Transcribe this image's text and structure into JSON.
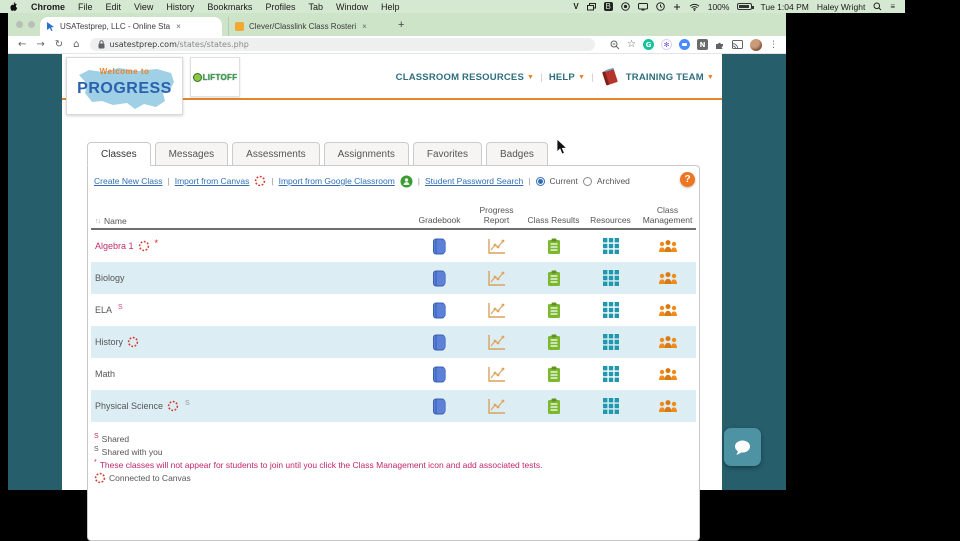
{
  "menubar": {
    "app": "Chrome",
    "items": [
      "File",
      "Edit",
      "View",
      "History",
      "Bookmarks",
      "Profiles",
      "Tab",
      "Window",
      "Help"
    ],
    "status": {
      "battery": "100%",
      "time": "Tue 1:04 PM",
      "user": "Haley Wright"
    },
    "status_icons": [
      "onepassword-icon",
      "windows-icon",
      "box-icon",
      "record-icon",
      "display-icon",
      "timemachine-icon",
      "input-icon",
      "wifi-icon",
      "spotlight-icon",
      "control-center-icon"
    ]
  },
  "browser": {
    "tabs": [
      {
        "title": "USATestprep, LLC - Online Sta",
        "close": "×"
      },
      {
        "title": "Clever/Classlink Class Rosteri",
        "close": "×"
      }
    ],
    "newtab": "+",
    "back": "←",
    "forward": "→",
    "reload": "↻",
    "home": "⌂",
    "url_domain": "usatestprep.com",
    "url_path": "/states/states.php",
    "star": "☆",
    "menu_dots": "⋮",
    "ext_g_label": "G",
    "ext_n_label": "N",
    "ext_flower": "✻"
  },
  "site": {
    "logo_line1": "Welcome to",
    "logo_line2": "PROGRESS",
    "liftoff_label": "LIFTOFF",
    "nav": [
      {
        "label": "CLASSROOM RESOURCES",
        "arrow": "▼"
      },
      {
        "label": "HELP",
        "arrow": "▼"
      },
      {
        "label": "TRAINING TEAM",
        "arrow": "▼",
        "icon": "training-book-icon"
      }
    ],
    "nav_separator": "|"
  },
  "tabs": {
    "active_index": 0,
    "items": [
      "Classes",
      "Messages",
      "Assessments",
      "Assignments",
      "Favorites",
      "Badges"
    ]
  },
  "linksrow": {
    "links": [
      {
        "label": "Create New Class"
      },
      {
        "label": "Import from Canvas",
        "icon": "canvas-icon"
      },
      {
        "label": "Import from Google Classroom",
        "icon": "google-classroom-icon"
      },
      {
        "label": "Student Password Search"
      }
    ],
    "separator": "|",
    "radio_current": {
      "label": "Current",
      "selected": true
    },
    "radio_archived": {
      "label": "Archived",
      "selected": false
    },
    "help_label": "?"
  },
  "classes": {
    "sort_glyph": "↑↓",
    "columns": [
      "Name",
      "Gradebook",
      "Progress Report",
      "Class Results",
      "Resources",
      "Class Management"
    ],
    "row_icons": [
      "gradebook-icon",
      "progress-report-icon",
      "class-results-icon",
      "resources-icon",
      "class-management-icon"
    ],
    "rows": [
      {
        "name": "Algebra 1",
        "canvas": true,
        "asterisk": true,
        "shared": null,
        "pink": true
      },
      {
        "name": "Biology",
        "canvas": false,
        "asterisk": false,
        "shared": null,
        "pink": false
      },
      {
        "name": "ELA",
        "canvas": false,
        "asterisk": false,
        "shared": "pink",
        "pink": false
      },
      {
        "name": "History",
        "canvas": true,
        "asterisk": false,
        "shared": null,
        "pink": false
      },
      {
        "name": "Math",
        "canvas": false,
        "asterisk": false,
        "shared": null,
        "pink": false
      },
      {
        "name": "Physical Science",
        "canvas": true,
        "asterisk": false,
        "shared": "gray",
        "pink": false
      }
    ]
  },
  "legend": [
    {
      "marker": "S",
      "marker_style": "pink",
      "text": "Shared",
      "pink_text": false
    },
    {
      "marker": "S",
      "marker_style": "gray",
      "text": "Shared with you",
      "pink_text": false
    },
    {
      "marker": "*",
      "marker_style": "pink",
      "text": "These classes will not appear for students to join until you click the Class Management icon and add associated tests.",
      "pink_text": true
    },
    {
      "marker": "canvas",
      "marker_style": "icon",
      "text": "Connected to Canvas",
      "pink_text": false
    }
  ],
  "colors": {
    "page_background": "#265e6c",
    "accent_orange": "#e8802a",
    "link_blue": "#2f6eb5",
    "pink": "#bf2f6a",
    "row_alt": "#dcedf4",
    "gradebook_blue": "#5b82d8",
    "chart_tan": "#e0a35e",
    "clipboard_green": "#7cb82f",
    "grid_teal": "#2099ae",
    "people_orange": "#f08c1e",
    "canvas_red": "#d23f31",
    "chat_teal": "#4e93a3"
  }
}
